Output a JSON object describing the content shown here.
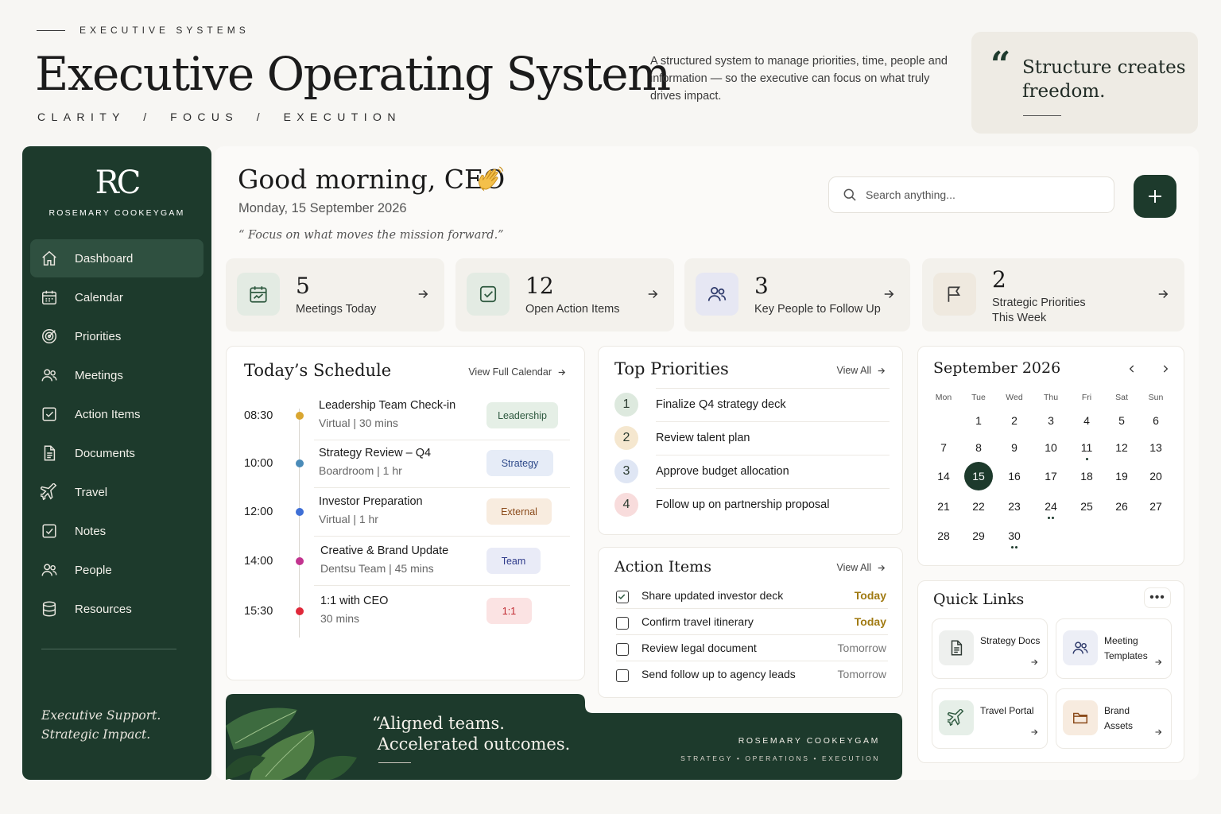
{
  "header": {
    "eyebrow": "EXECUTIVE SYSTEMS",
    "title": "Executive Operating System",
    "tagline": "CLARITY  /  FOCUS  /  EXECUTION",
    "description": "A structured system to manage priorities, time, people and information — so the executive can focus on what truly drives impact.",
    "quote": "Structure creates freedom."
  },
  "sidebar": {
    "logo": "RC",
    "brand": "ROSEMARY COOKEYGAM",
    "items": [
      {
        "label": "Dashboard",
        "icon": "home-icon",
        "active": true
      },
      {
        "label": "Calendar",
        "icon": "calendar-icon"
      },
      {
        "label": "Priorities",
        "icon": "target-icon"
      },
      {
        "label": "Meetings",
        "icon": "users-icon"
      },
      {
        "label": "Action Items",
        "icon": "checkbox-icon"
      },
      {
        "label": "Documents",
        "icon": "document-icon"
      },
      {
        "label": "Travel",
        "icon": "airplane-icon"
      },
      {
        "label": "Notes",
        "icon": "note-check-icon"
      },
      {
        "label": "People",
        "icon": "people-icon"
      },
      {
        "label": "Resources",
        "icon": "database-icon"
      }
    ],
    "footer_line1": "Executive Support.",
    "footer_line2": "Strategic Impact."
  },
  "main": {
    "greeting": "Good morning, CEO",
    "greeting_emoji": "waving-hand-icon",
    "date": "Monday, 15 September 2026",
    "focus_quote": "“ Focus on what moves the mission forward.”",
    "search_placeholder": "Search anything..."
  },
  "stats": [
    {
      "value": "5",
      "label": "Meetings Today",
      "icon": "calendar-chart-icon"
    },
    {
      "value": "12",
      "label": "Open Action Items",
      "icon": "check-square-icon"
    },
    {
      "value": "3",
      "label": "Key People to Follow Up",
      "icon": "users-icon"
    },
    {
      "value": "2",
      "label_line1": "Strategic Priorities",
      "label_line2": "This Week",
      "icon": "flag-icon"
    }
  ],
  "schedule": {
    "title": "Today’s Schedule",
    "link": "View Full Calendar",
    "items": [
      {
        "time": "08:30",
        "title": "Leadership Team Check-in",
        "sub": "Virtual | 30 mins",
        "tag": "Leadership",
        "color": "#d9a630"
      },
      {
        "time": "10:00",
        "title": "Strategy Review – Q4",
        "sub": "Boardroom | 1 hr",
        "tag": "Strategy",
        "color": "#4a8bb8"
      },
      {
        "time": "12:00",
        "title": "Investor Preparation",
        "sub": "Virtual | 1 hr",
        "tag": "External",
        "color": "#3f6fd6"
      },
      {
        "time": "14:00",
        "title": "Creative & Brand Update",
        "sub": "Dentsu Team | 45 mins",
        "tag": "Team",
        "color": "#c2338f"
      },
      {
        "time": "15:30",
        "title": "1:1 with CEO",
        "sub": "30 mins",
        "tag": "1:1",
        "color": "#e0283a"
      }
    ]
  },
  "priorities": {
    "title": "Top Priorities",
    "link": "View All",
    "items": [
      {
        "num": "1",
        "text": "Finalize Q4 strategy deck"
      },
      {
        "num": "2",
        "text": "Review talent plan"
      },
      {
        "num": "3",
        "text": "Approve budget allocation"
      },
      {
        "num": "4",
        "text": "Follow up on partnership proposal"
      }
    ]
  },
  "actions": {
    "title": "Action Items",
    "link": "View All",
    "items": [
      {
        "text": "Share updated investor deck",
        "due": "Today",
        "checked": true
      },
      {
        "text": "Confirm travel itinerary",
        "due": "Today",
        "checked": false
      },
      {
        "text": "Review legal document",
        "due": "Tomorrow",
        "checked": false
      },
      {
        "text": "Send follow up to agency leads",
        "due": "Tomorrow",
        "checked": false
      }
    ]
  },
  "calendar": {
    "month": "September 2026",
    "weekdays": [
      "Mon",
      "Tue",
      "Wed",
      "Thu",
      "Fri",
      "Sat",
      "Sun"
    ],
    "first_weekday_index": 1,
    "days_in_month": 30,
    "selected": 15,
    "events": {
      "11": 1,
      "24": 2,
      "30": 2
    }
  },
  "quick_links": {
    "title": "Quick Links",
    "items": [
      {
        "label": "Strategy Docs",
        "icon": "document-icon"
      },
      {
        "label": "Meeting\nTemplates",
        "icon": "users-icon"
      },
      {
        "label": "Travel Portal",
        "icon": "airplane-icon"
      },
      {
        "label": "Brand\nAssets",
        "icon": "folder-icon"
      }
    ]
  },
  "banner": {
    "quote": "“Aligned teams.\n Accelerated outcomes.",
    "brand": "ROSEMARY COOKEYGAM",
    "tags": "STRATEGY • OPERATIONS • EXECUTION"
  },
  "colors": {
    "primary": "#1d3a2c",
    "accent_today": "#a07a12",
    "background": "#f7f6f3"
  }
}
